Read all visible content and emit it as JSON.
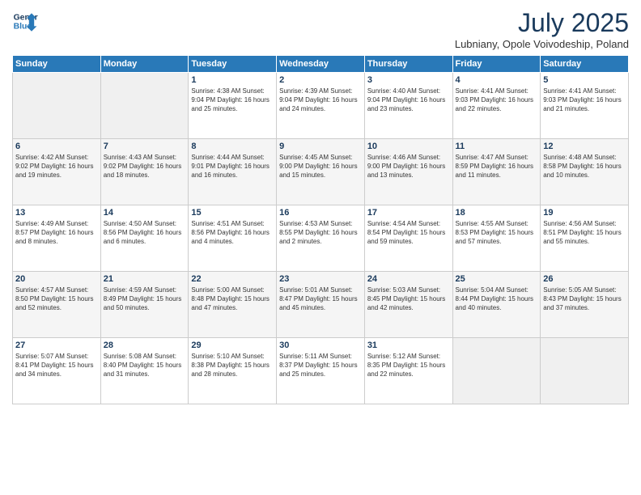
{
  "logo": {
    "line1": "General",
    "line2": "Blue"
  },
  "title": "July 2025",
  "location": "Lubniany, Opole Voivodeship, Poland",
  "weekdays": [
    "Sunday",
    "Monday",
    "Tuesday",
    "Wednesday",
    "Thursday",
    "Friday",
    "Saturday"
  ],
  "days": [
    {
      "num": "",
      "info": ""
    },
    {
      "num": "",
      "info": ""
    },
    {
      "num": "1",
      "info": "Sunrise: 4:38 AM\nSunset: 9:04 PM\nDaylight: 16 hours\nand 25 minutes."
    },
    {
      "num": "2",
      "info": "Sunrise: 4:39 AM\nSunset: 9:04 PM\nDaylight: 16 hours\nand 24 minutes."
    },
    {
      "num": "3",
      "info": "Sunrise: 4:40 AM\nSunset: 9:04 PM\nDaylight: 16 hours\nand 23 minutes."
    },
    {
      "num": "4",
      "info": "Sunrise: 4:41 AM\nSunset: 9:03 PM\nDaylight: 16 hours\nand 22 minutes."
    },
    {
      "num": "5",
      "info": "Sunrise: 4:41 AM\nSunset: 9:03 PM\nDaylight: 16 hours\nand 21 minutes."
    },
    {
      "num": "6",
      "info": "Sunrise: 4:42 AM\nSunset: 9:02 PM\nDaylight: 16 hours\nand 19 minutes."
    },
    {
      "num": "7",
      "info": "Sunrise: 4:43 AM\nSunset: 9:02 PM\nDaylight: 16 hours\nand 18 minutes."
    },
    {
      "num": "8",
      "info": "Sunrise: 4:44 AM\nSunset: 9:01 PM\nDaylight: 16 hours\nand 16 minutes."
    },
    {
      "num": "9",
      "info": "Sunrise: 4:45 AM\nSunset: 9:00 PM\nDaylight: 16 hours\nand 15 minutes."
    },
    {
      "num": "10",
      "info": "Sunrise: 4:46 AM\nSunset: 9:00 PM\nDaylight: 16 hours\nand 13 minutes."
    },
    {
      "num": "11",
      "info": "Sunrise: 4:47 AM\nSunset: 8:59 PM\nDaylight: 16 hours\nand 11 minutes."
    },
    {
      "num": "12",
      "info": "Sunrise: 4:48 AM\nSunset: 8:58 PM\nDaylight: 16 hours\nand 10 minutes."
    },
    {
      "num": "13",
      "info": "Sunrise: 4:49 AM\nSunset: 8:57 PM\nDaylight: 16 hours\nand 8 minutes."
    },
    {
      "num": "14",
      "info": "Sunrise: 4:50 AM\nSunset: 8:56 PM\nDaylight: 16 hours\nand 6 minutes."
    },
    {
      "num": "15",
      "info": "Sunrise: 4:51 AM\nSunset: 8:56 PM\nDaylight: 16 hours\nand 4 minutes."
    },
    {
      "num": "16",
      "info": "Sunrise: 4:53 AM\nSunset: 8:55 PM\nDaylight: 16 hours\nand 2 minutes."
    },
    {
      "num": "17",
      "info": "Sunrise: 4:54 AM\nSunset: 8:54 PM\nDaylight: 15 hours\nand 59 minutes."
    },
    {
      "num": "18",
      "info": "Sunrise: 4:55 AM\nSunset: 8:53 PM\nDaylight: 15 hours\nand 57 minutes."
    },
    {
      "num": "19",
      "info": "Sunrise: 4:56 AM\nSunset: 8:51 PM\nDaylight: 15 hours\nand 55 minutes."
    },
    {
      "num": "20",
      "info": "Sunrise: 4:57 AM\nSunset: 8:50 PM\nDaylight: 15 hours\nand 52 minutes."
    },
    {
      "num": "21",
      "info": "Sunrise: 4:59 AM\nSunset: 8:49 PM\nDaylight: 15 hours\nand 50 minutes."
    },
    {
      "num": "22",
      "info": "Sunrise: 5:00 AM\nSunset: 8:48 PM\nDaylight: 15 hours\nand 47 minutes."
    },
    {
      "num": "23",
      "info": "Sunrise: 5:01 AM\nSunset: 8:47 PM\nDaylight: 15 hours\nand 45 minutes."
    },
    {
      "num": "24",
      "info": "Sunrise: 5:03 AM\nSunset: 8:45 PM\nDaylight: 15 hours\nand 42 minutes."
    },
    {
      "num": "25",
      "info": "Sunrise: 5:04 AM\nSunset: 8:44 PM\nDaylight: 15 hours\nand 40 minutes."
    },
    {
      "num": "26",
      "info": "Sunrise: 5:05 AM\nSunset: 8:43 PM\nDaylight: 15 hours\nand 37 minutes."
    },
    {
      "num": "27",
      "info": "Sunrise: 5:07 AM\nSunset: 8:41 PM\nDaylight: 15 hours\nand 34 minutes."
    },
    {
      "num": "28",
      "info": "Sunrise: 5:08 AM\nSunset: 8:40 PM\nDaylight: 15 hours\nand 31 minutes."
    },
    {
      "num": "29",
      "info": "Sunrise: 5:10 AM\nSunset: 8:38 PM\nDaylight: 15 hours\nand 28 minutes."
    },
    {
      "num": "30",
      "info": "Sunrise: 5:11 AM\nSunset: 8:37 PM\nDaylight: 15 hours\nand 25 minutes."
    },
    {
      "num": "31",
      "info": "Sunrise: 5:12 AM\nSunset: 8:35 PM\nDaylight: 15 hours\nand 22 minutes."
    },
    {
      "num": "",
      "info": ""
    },
    {
      "num": "",
      "info": ""
    }
  ]
}
